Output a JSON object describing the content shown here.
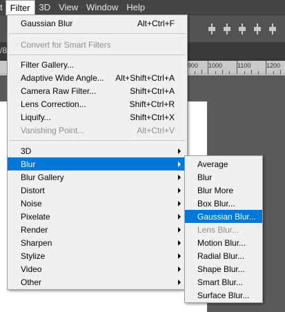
{
  "menubar": {
    "items": [
      {
        "label": "t",
        "active": false
      },
      {
        "label": "Filter",
        "active": true
      },
      {
        "label": "3D",
        "active": false
      },
      {
        "label": "View",
        "active": false
      },
      {
        "label": "Window",
        "active": false
      },
      {
        "label": "Help",
        "active": false
      }
    ]
  },
  "tabstrip": {
    "fragment": "/8"
  },
  "ruler": {
    "labels": [
      "900",
      "1000",
      "1100",
      "1200"
    ]
  },
  "filter_menu": {
    "last_filter": {
      "label": "Gaussian Blur",
      "shortcut": "Alt+Ctrl+F"
    },
    "convert": {
      "label": "Convert for Smart Filters"
    },
    "group1": [
      {
        "label": "Filter Gallery...",
        "shortcut": ""
      },
      {
        "label": "Adaptive Wide Angle...",
        "shortcut": "Alt+Shift+Ctrl+A"
      },
      {
        "label": "Camera Raw Filter...",
        "shortcut": "Shift+Ctrl+A"
      },
      {
        "label": "Lens Correction...",
        "shortcut": "Shift+Ctrl+R"
      },
      {
        "label": "Liquify...",
        "shortcut": "Shift+Ctrl+X"
      },
      {
        "label": "Vanishing Point...",
        "shortcut": "Alt+Ctrl+V"
      }
    ],
    "categories": [
      {
        "label": "3D"
      },
      {
        "label": "Blur"
      },
      {
        "label": "Blur Gallery"
      },
      {
        "label": "Distort"
      },
      {
        "label": "Noise"
      },
      {
        "label": "Pixelate"
      },
      {
        "label": "Render"
      },
      {
        "label": "Sharpen"
      },
      {
        "label": "Stylize"
      },
      {
        "label": "Video"
      },
      {
        "label": "Other"
      }
    ]
  },
  "blur_submenu": {
    "items": [
      {
        "label": "Average"
      },
      {
        "label": "Blur"
      },
      {
        "label": "Blur More"
      },
      {
        "label": "Box Blur..."
      },
      {
        "label": "Gaussian Blur..."
      },
      {
        "label": "Lens Blur..."
      },
      {
        "label": "Motion Blur..."
      },
      {
        "label": "Radial Blur..."
      },
      {
        "label": "Shape Blur..."
      },
      {
        "label": "Smart Blur..."
      },
      {
        "label": "Surface Blur..."
      }
    ]
  },
  "colors": {
    "highlight": "#0078d7",
    "menu_bg": "#f0f0f0",
    "disabled_text": "#8e8e8e"
  }
}
